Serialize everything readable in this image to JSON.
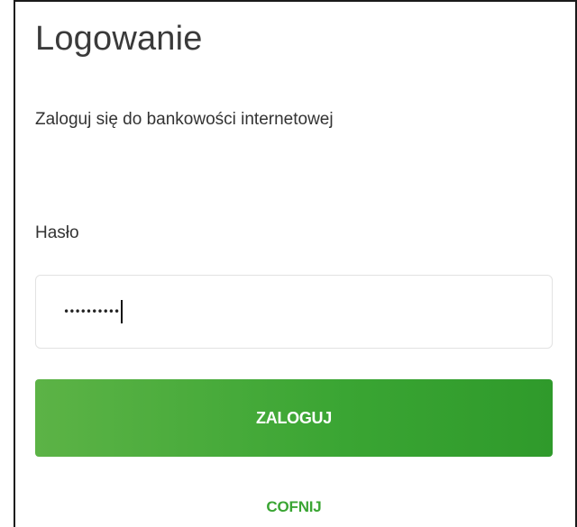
{
  "login": {
    "title": "Logowanie",
    "subtitle": "Zaloguj się do bankowości internetowej",
    "password_label": "Hasło",
    "password_value_masked": "••••••••••",
    "submit_label": "ZALOGUJ",
    "back_label": "COFNIJ"
  },
  "colors": {
    "accent_green": "#3aa533",
    "button_text": "#ffffff",
    "title_text": "#3a3a3a"
  }
}
